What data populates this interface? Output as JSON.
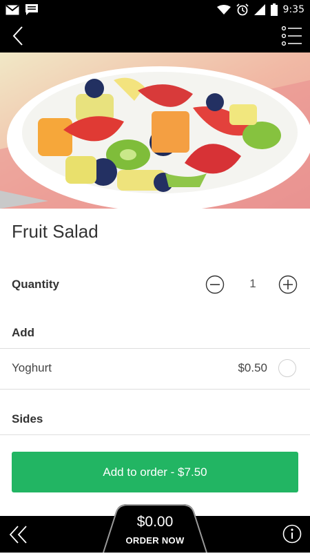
{
  "status_bar": {
    "time": "9:35",
    "left_icons": [
      "gmail-icon",
      "message-icon"
    ],
    "right_icons": [
      "wifi-icon",
      "alarm-icon",
      "signal-icon",
      "battery-icon"
    ]
  },
  "app_bar": {
    "back_icon": "chevron-left-icon",
    "menu_icon": "list-menu-icon"
  },
  "hero": {
    "image": "fruit-salad-bowl-photo"
  },
  "product": {
    "title": "Fruit Salad"
  },
  "quantity": {
    "label": "Quantity",
    "value": "1"
  },
  "sections": {
    "add": {
      "label": "Add",
      "options": [
        {
          "name": "Yoghurt",
          "price": "$0.50",
          "selected": false
        }
      ]
    },
    "sides": {
      "label": "Sides"
    }
  },
  "cta": {
    "label": "Add to order - $7.50",
    "color": "#22b563"
  },
  "bottom_bar": {
    "order_total": "$0.00",
    "order_label": "ORDER NOW",
    "prev_icon": "double-chevron-left-icon",
    "info_icon": "info-icon"
  }
}
